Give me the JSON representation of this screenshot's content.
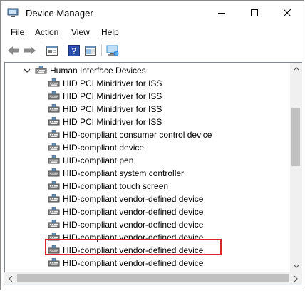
{
  "window": {
    "title": "Device Manager"
  },
  "menu": [
    "File",
    "Action",
    "View",
    "Help"
  ],
  "tree": {
    "category": "Human Interface Devices",
    "devices": [
      "HID PCI Minidriver for ISS",
      "HID PCI Minidriver for ISS",
      "HID PCI Minidriver for ISS",
      "HID PCI Minidriver for ISS",
      "HID-compliant consumer control device",
      "HID-compliant device",
      "HID-compliant pen",
      "HID-compliant system controller",
      "HID-compliant touch screen",
      "HID-compliant vendor-defined device",
      "HID-compliant vendor-defined device",
      "HID-compliant vendor-defined device",
      "HID-compliant vendor-defined device",
      "HID-compliant vendor-defined device",
      "HID-compliant vendor-defined device"
    ],
    "highlighted_device": "HID-compliant touch screen"
  },
  "colors": {
    "highlight": "#d9262c",
    "accent": "#2b78d8"
  },
  "icons": {
    "app": "device-manager-icon",
    "device": "hid-device-icon",
    "toolbar": [
      "back-arrow-icon",
      "forward-arrow-icon",
      "properties-icon",
      "help-icon",
      "view-icon",
      "monitor-icon"
    ]
  }
}
